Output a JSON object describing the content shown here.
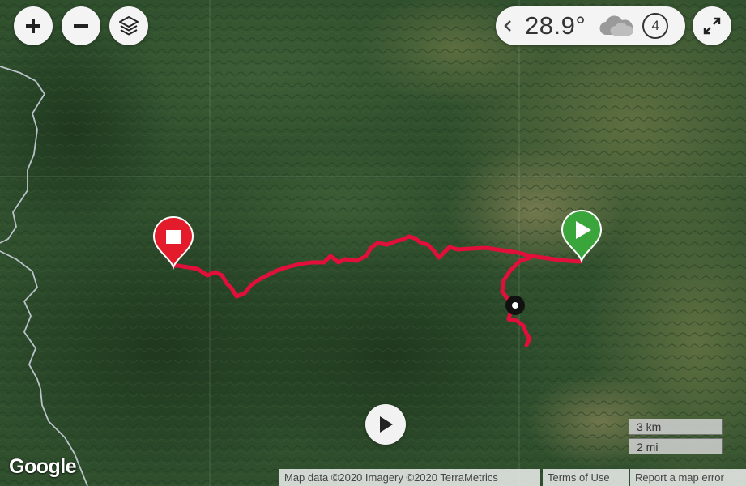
{
  "map": {
    "controls": {
      "zoom_in_icon": "plus-icon",
      "zoom_out_icon": "minus-icon",
      "layers_icon": "layers-icon",
      "fullscreen_icon": "expand-icon",
      "play_icon": "play-icon"
    },
    "weather": {
      "temperature": "28.9°",
      "condition_icon": "cloud-icon",
      "forecast_count": "4"
    },
    "scale": {
      "km_label": "3 km",
      "mi_label": "2 mi"
    },
    "branding": {
      "logo_text": "Google"
    },
    "attribution": {
      "map_data": "Map data ©2020 Imagery ©2020 TerraMetrics",
      "terms": "Terms of Use",
      "report": "Report a map error"
    },
    "markers": {
      "start_icon": "play-icon",
      "finish_icon": "stop-icon",
      "current_icon": "position-dot-icon"
    },
    "colors": {
      "route": "#e0103a",
      "finish_marker": "#e41b2a",
      "start_marker": "#3aa53a"
    }
  }
}
